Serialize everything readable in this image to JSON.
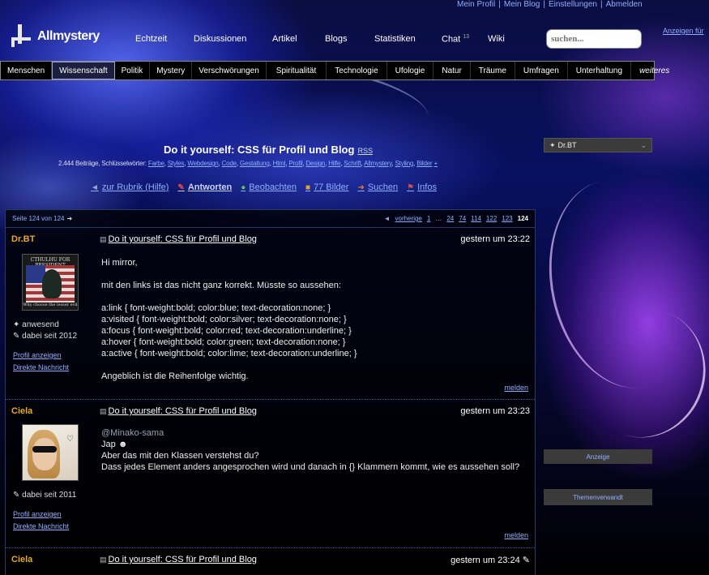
{
  "top_links": [
    "Mein Profil",
    "Mein Blog",
    "Einstellungen",
    "Abmelden"
  ],
  "logo_text": "Allmystery",
  "main_nav": [
    {
      "label": "Echtzeit"
    },
    {
      "label": "Diskussionen"
    },
    {
      "label": "Artikel"
    },
    {
      "label": "Blogs"
    },
    {
      "label": "Statistiken"
    },
    {
      "label": "Chat",
      "badge": "13"
    },
    {
      "label": "Wiki"
    }
  ],
  "search_placeholder": "suchen...",
  "ad_link": "Anzeigen für",
  "categories": [
    "Menschen",
    "Wissenschaft",
    "Politik",
    "Mystery",
    "Verschwörungen",
    "Spiritualität",
    "Technologie",
    "Ufologie",
    "Natur",
    "Träume",
    "Umfragen",
    "Unterhaltung",
    "weiteres"
  ],
  "thread": {
    "title": "Do it yourself: CSS für Profil und Blog",
    "rss": "RSS",
    "stats_prefix": "2.444 Beiträge, Schlüsselwörter:",
    "keywords": [
      "Farbe",
      "Styles",
      "Webdesign",
      "Code",
      "Gestaltung",
      "Html",
      "Profil",
      "Design",
      "Hilfe",
      "Schrift",
      "Allmystery",
      "Styling",
      "Bilder"
    ],
    "keywords_more": "+"
  },
  "actions": [
    {
      "label": "zur Rubrik (Hilfe)",
      "icon": "arrow-left-icon",
      "bold": false
    },
    {
      "label": "Antworten",
      "icon": "reply-icon",
      "bold": true
    },
    {
      "label": "Beobachten",
      "icon": "watch-icon",
      "bold": false
    },
    {
      "label": "77 Bilder",
      "icon": "images-icon",
      "bold": false
    },
    {
      "label": "Suchen",
      "icon": "search-icon",
      "bold": false
    },
    {
      "label": "Infos",
      "icon": "info-icon",
      "bold": false
    }
  ],
  "sidebar": {
    "user": "Dr.BT",
    "ad_label": "Anzeige",
    "related_label": "Themenverwandt"
  },
  "pager": {
    "label": "Seite 124 von 124",
    "prev": "vorherige",
    "pages": [
      "1",
      "…",
      "24",
      "74",
      "114",
      "122",
      "123",
      "124"
    ],
    "current": "124"
  },
  "posts": [
    {
      "author": "Dr.BT",
      "title": "Do it yourself: CSS für Profil und Blog",
      "time": "gestern um 23:22",
      "status": "anwesend",
      "since": "dabei seit 2012",
      "profile_link": "Profil anzeigen",
      "message_link": "Direkte Nachricht",
      "report": "melden",
      "avatar_text": "CTHULHU FOR PRESIDENT",
      "avatar_sub": "Why choose the lesser evil",
      "lines": [
        "Hi mirror,",
        "",
        "mit den links ist das nicht ganz korrekt. Müsste so aussehen:",
        "",
        "a:link { font-weight:bold; color:blue; text-decoration:none; }",
        "a:visited { font-weight:bold; color:silver; text-decoration:none; }",
        "a:focus { font-weight:bold; color:red; text-decoration:underline; }",
        "a:hover { font-weight:bold; color:green; text-decoration:none; }",
        "a:active { font-weight:bold; color:lime; text-decoration:underline; }",
        "",
        "Angeblich ist die Reihenfolge wichtig."
      ]
    },
    {
      "author": "Ciela",
      "title": "Do it yourself: CSS für Profil und Blog",
      "time": "gestern um 23:23",
      "since": "dabei seit 2011",
      "profile_link": "Profil anzeigen",
      "message_link": "Direkte Nachricht",
      "report": "melden",
      "mention": "@Minako-sama",
      "lines": [
        "Jap",
        "Aber das mit den Klassen verstehst du?",
        "Dass jedes Element anders angesprochen wird und danach in {} Klammern kommt, wie es aussehen soll?"
      ]
    },
    {
      "author": "Ciela",
      "title": "Do it yourself: CSS für Profil und Blog",
      "time": "gestern um 23:24"
    }
  ],
  "colors": {
    "accent_link": "#8fb0ff",
    "author": "#e7a92b",
    "panel": "#000000"
  }
}
